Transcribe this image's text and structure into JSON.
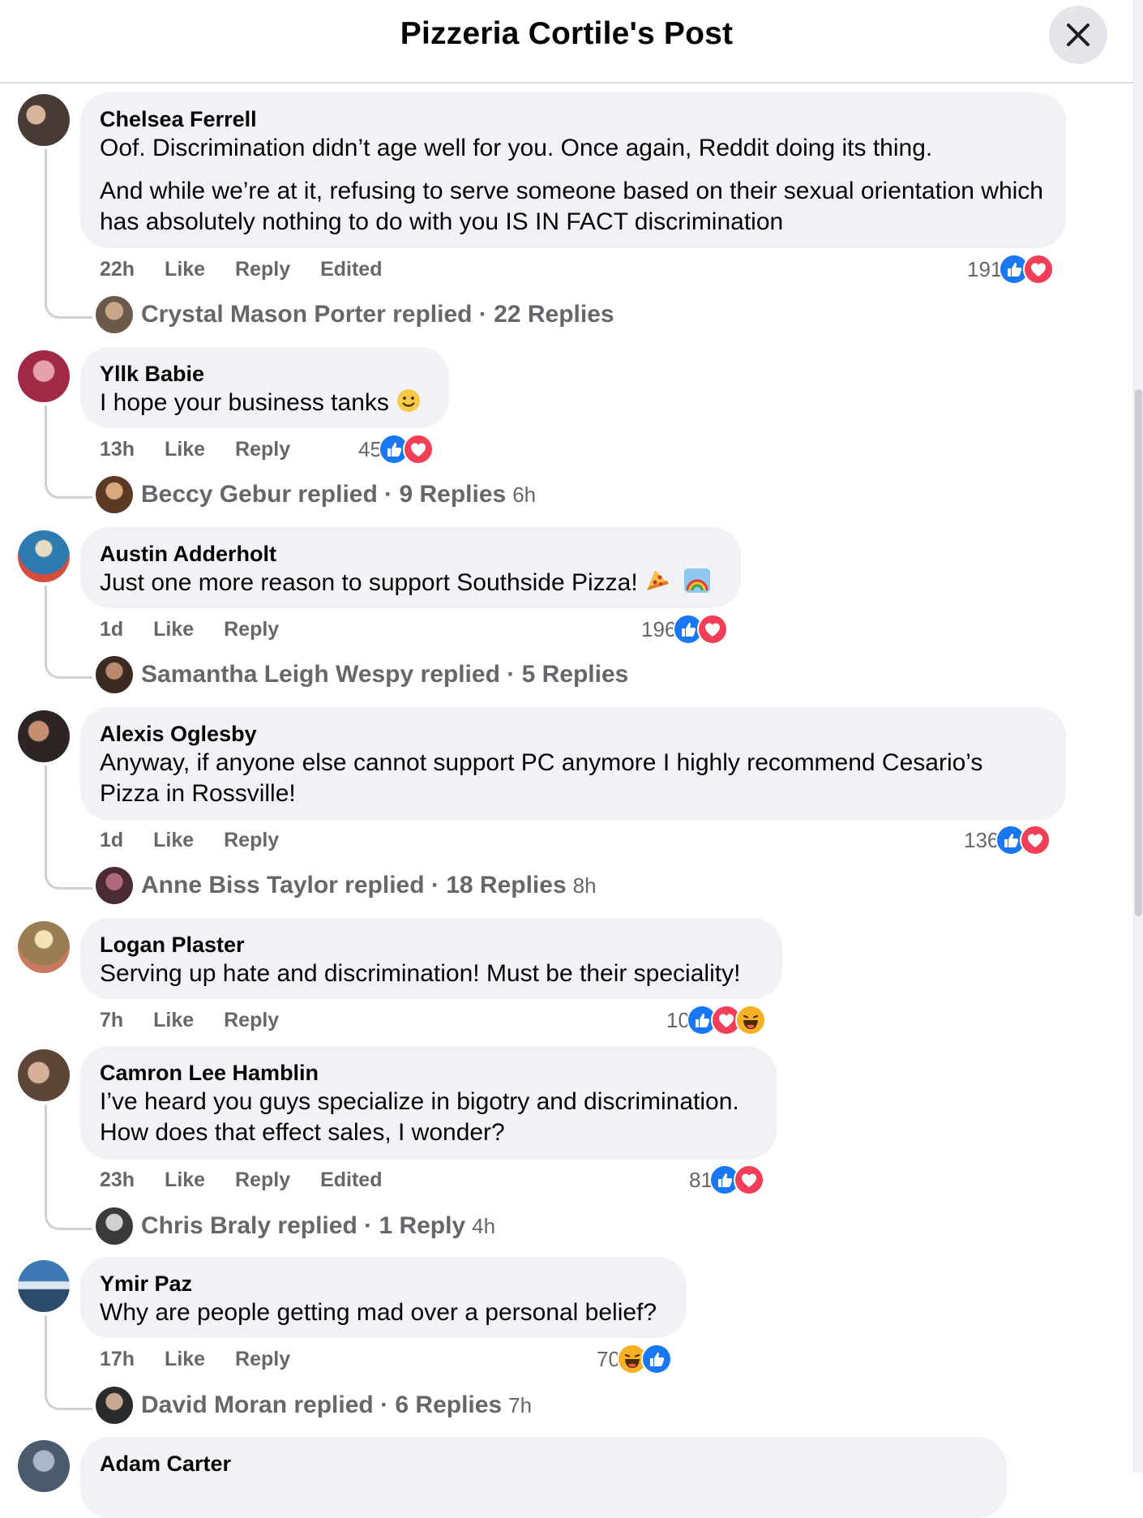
{
  "header": {
    "title": "Pizzeria Cortile's Post"
  },
  "icons": {
    "close": "close-icon",
    "like": "like-reaction-icon",
    "love": "love-reaction-icon",
    "haha": "haha-reaction-icon"
  },
  "colors": {
    "like": "#1877f2",
    "love": "#f33e58",
    "haha": "#f7b125",
    "bubble": "#f0f2f5",
    "meta": "#65676b"
  },
  "comments": [
    {
      "author": "Chelsea Ferrell",
      "text": "Oof. Discrimination didn’t age well for you. Once again, Reddit doing its thing.",
      "text2": "And while we’re at it, refusing to serve someone based on their sexual orientation which has absolutely nothing to do with you IS IN FACT discrimination",
      "time": "22h",
      "like": "Like",
      "reply": "Reply",
      "edited": "Edited",
      "reaction_count": "191",
      "replier": "Crystal Mason Porter replied",
      "reply_count": "22 Replies",
      "reply_time": ""
    },
    {
      "author": "Yllk Babie",
      "text": "I hope your business tanks",
      "time": "13h",
      "like": "Like",
      "reply": "Reply",
      "reaction_count": "45",
      "replier": "Beccy Gebur replied",
      "reply_count": "9 Replies",
      "reply_time": "6h"
    },
    {
      "author": "Austin Adderholt",
      "text": "Just one more reason to support Southside Pizza!",
      "time": "1d",
      "like": "Like",
      "reply": "Reply",
      "reaction_count": "196",
      "replier": "Samantha Leigh Wespy replied",
      "reply_count": "5 Replies",
      "reply_time": ""
    },
    {
      "author": "Alexis Oglesby",
      "text": "Anyway, if anyone else cannot support PC anymore I highly recommend Cesario’s Pizza in Rossville!",
      "time": "1d",
      "like": "Like",
      "reply": "Reply",
      "reaction_count": "136",
      "replier": "Anne Biss Taylor replied",
      "reply_count": "18 Replies",
      "reply_time": "8h"
    },
    {
      "author": "Logan Plaster",
      "text": "Serving up hate and discrimination! Must be their speciality!",
      "time": "7h",
      "like": "Like",
      "reply": "Reply",
      "reaction_count": "10"
    },
    {
      "author": "Camron Lee Hamblin",
      "text": "I’ve heard you guys specialize in bigotry and discrimination. How does that effect sales, I wonder?",
      "time": "23h",
      "like": "Like",
      "reply": "Reply",
      "edited": "Edited",
      "reaction_count": "81",
      "replier": "Chris Braly replied",
      "reply_count": "1 Reply",
      "reply_time": "4h"
    },
    {
      "author": "Ymir Paz",
      "text": "Why are people getting mad over a personal belief?",
      "time": "17h",
      "like": "Like",
      "reply": "Reply",
      "reaction_count": "70",
      "replier": "David Moran replied",
      "reply_count": "6 Replies",
      "reply_time": "7h"
    },
    {
      "author": "Adam Carter"
    }
  ]
}
